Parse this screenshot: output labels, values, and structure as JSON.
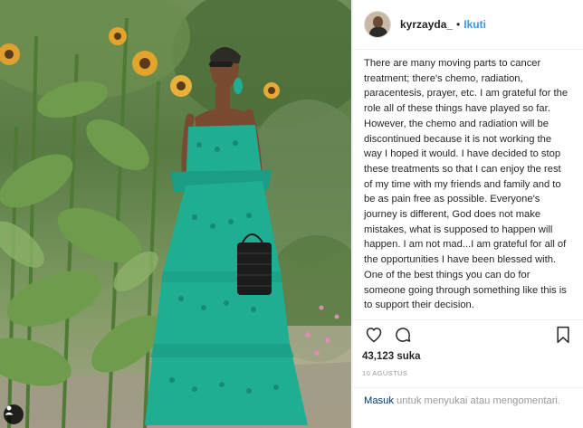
{
  "post": {
    "username": "kyrzayda_",
    "separator": "•",
    "follow_label": "Ikuti",
    "caption": "There are many moving parts to cancer treatment; there's chemo, radiation, paracentesis, prayer, etc. I am grateful for the role all of these things have played so far. However, the chemo and radiation will be discontinued because it is not working the way I hoped it would. I have decided to stop these treatments so that I can enjoy the rest of my time with my friends and family and to be as pain free as possible. Everyone's journey is different, God does not make mistakes, what is supposed to happen will happen. I am not mad...I am grateful for all of the opportunities I have been blessed with. One of the best things you can do for someone going through something like this is to support their decision.\nI will never give up on my fight. Please continue to share your stories, your love,",
    "likes": "43,123 suka",
    "date": "10 AGUSTUS",
    "login_link": "Masuk",
    "login_text": " untuk menyukai atau mengomentari."
  },
  "icons": {
    "like": "heart-icon",
    "comment": "comment-icon",
    "save": "bookmark-icon",
    "avatar": "avatar",
    "owner_badge": "user-badge-icon"
  },
  "colors": {
    "follow": "#3897f0",
    "dress": "#1fae92",
    "link": "#003569",
    "muted": "#999999"
  }
}
